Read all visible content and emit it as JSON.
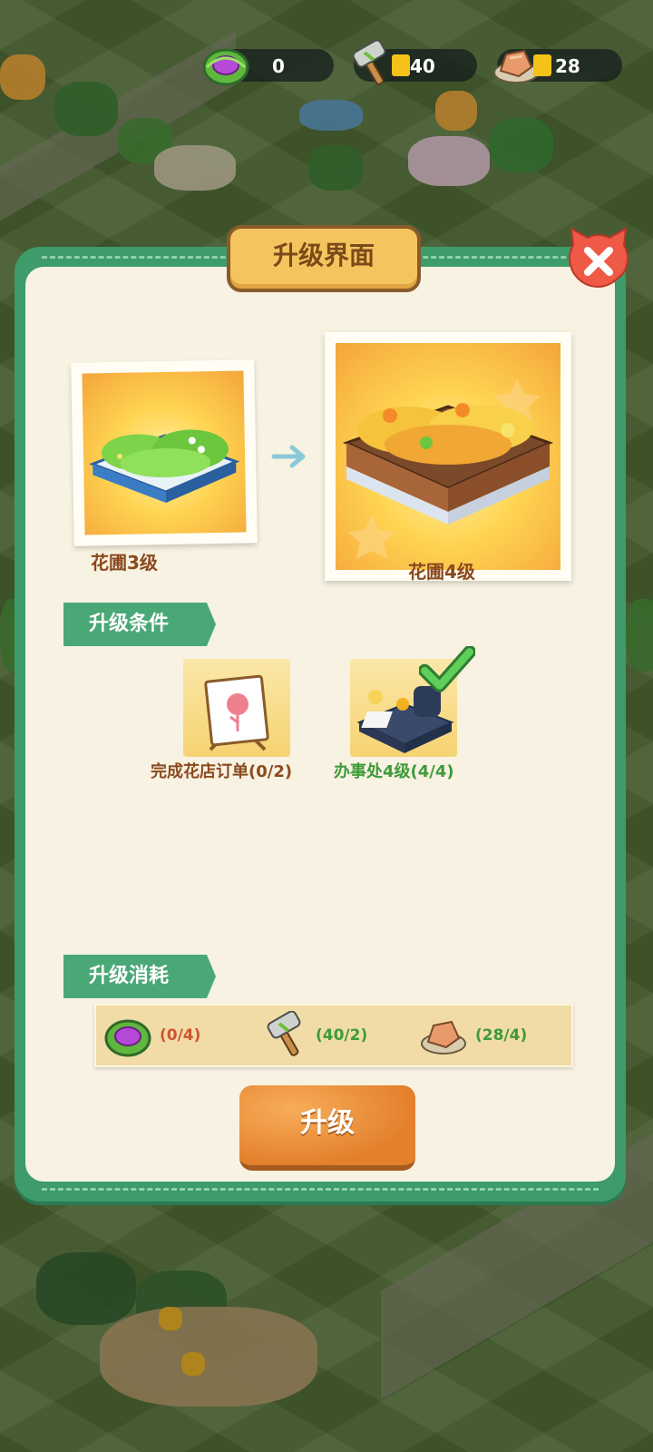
{
  "resources": [
    {
      "icon": "cabbage-icon",
      "value": "0"
    },
    {
      "icon": "hammer-icon",
      "value": "40"
    },
    {
      "icon": "stone-icon",
      "value": "28"
    }
  ],
  "panel": {
    "title": "升级界面",
    "current": {
      "label": "花圃3级"
    },
    "next": {
      "label": "花圃4级"
    }
  },
  "conditions": {
    "header": "升级条件",
    "items": [
      {
        "label": "完成花店订单(0/2)",
        "met": false,
        "color": "#8a4a1e"
      },
      {
        "label": "办事处4级(4/4)",
        "met": true,
        "color": "#3f9a3a"
      }
    ]
  },
  "costs": {
    "header": "升级消耗",
    "items": [
      {
        "icon": "cabbage-icon",
        "text": "(0/4)",
        "color": "#d0532e"
      },
      {
        "icon": "hammer-icon",
        "text": "(40/2)",
        "color": "#3f9a3a"
      },
      {
        "icon": "stone-icon",
        "text": "(28/4)",
        "color": "#3f9a3a"
      }
    ]
  },
  "upgrade_button": "升级",
  "colors": {
    "panel": "#3d9c69",
    "accent": "#e4802c",
    "ribbon": "#4aa877"
  }
}
